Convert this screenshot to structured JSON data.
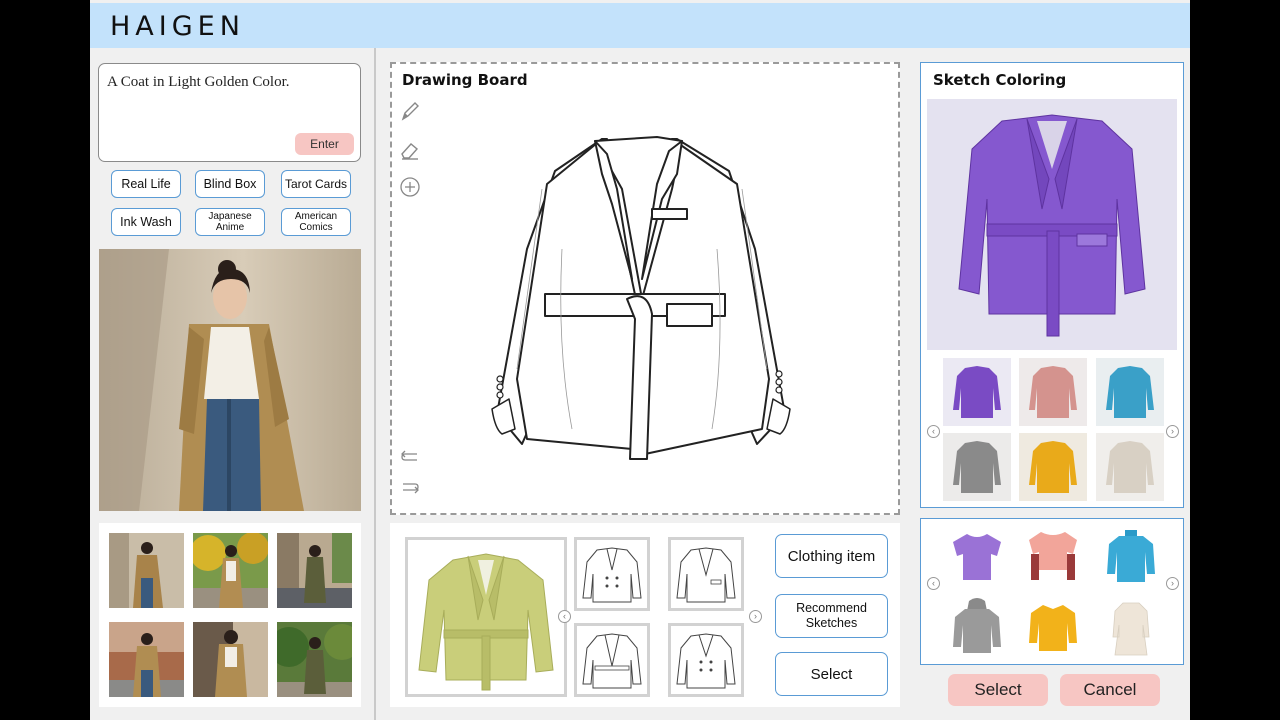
{
  "app": {
    "title": "HAIGEN"
  },
  "prompt": {
    "text": "A Coat in Light Golden Color.",
    "enter_label": "Enter"
  },
  "styles": [
    {
      "label": "Real Life"
    },
    {
      "label": "Blind Box"
    },
    {
      "label": "Tarot Cards"
    },
    {
      "label": "Ink Wash"
    },
    {
      "label": "Japanese Anime"
    },
    {
      "label": "American Comics"
    }
  ],
  "board": {
    "title": "Drawing Board"
  },
  "coloring": {
    "title": "Sketch Coloring",
    "swatch_colors": [
      "#7a4bc4",
      "#d4938e",
      "#3aa0c8",
      "#8a8a8a",
      "#e9aa1a",
      "#d8d0c4"
    ]
  },
  "actions": {
    "clothing_item": "Clothing item",
    "recommend": "Recommend Sketches",
    "select": "Select"
  },
  "footer": {
    "select": "Select",
    "cancel": "Cancel"
  },
  "colors": {
    "header": "#c3e2fb",
    "accent": "#5a9bd5",
    "pink": "#f7c6c3"
  }
}
